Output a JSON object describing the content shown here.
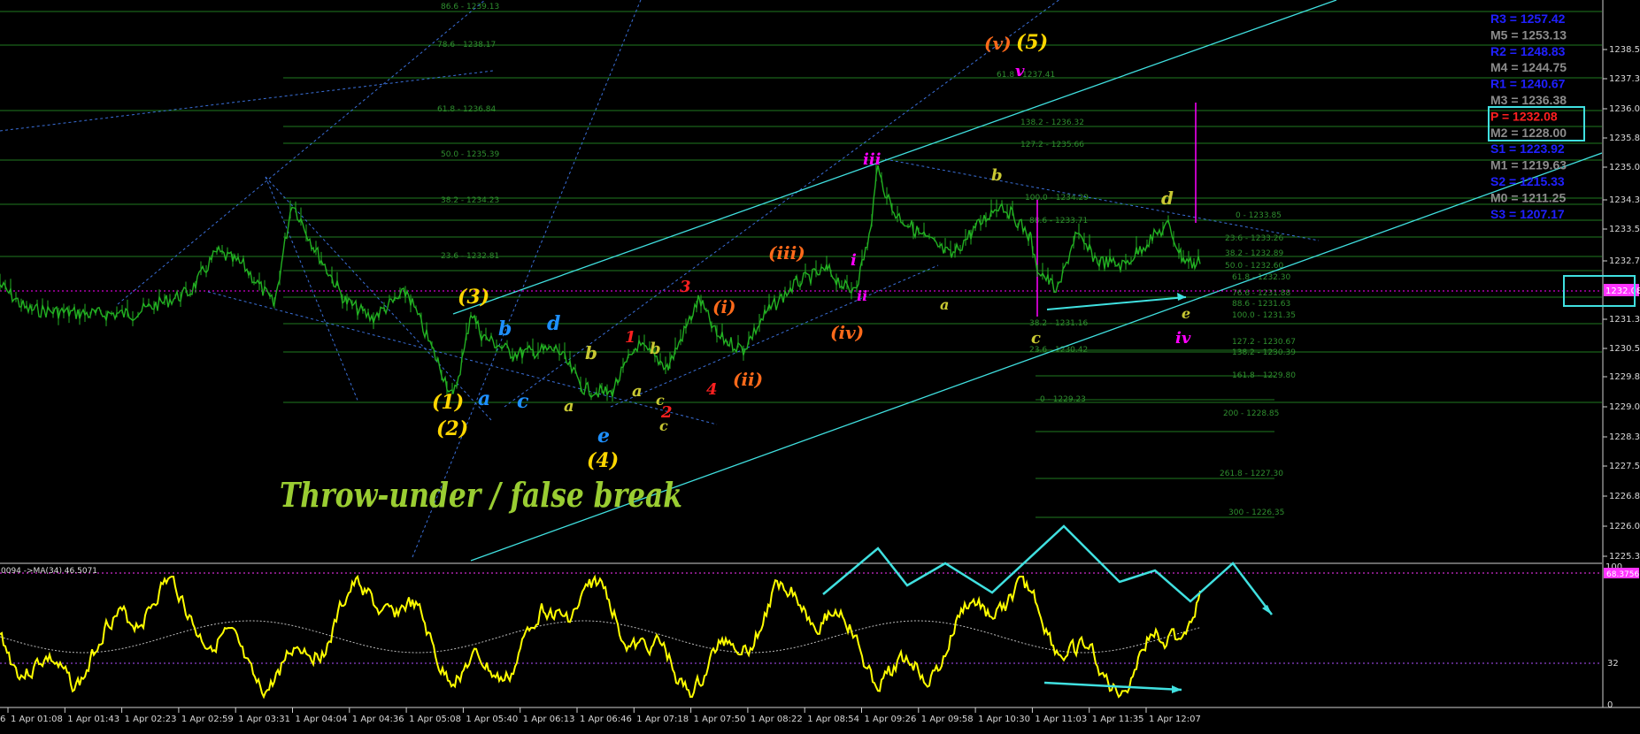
{
  "chart_data": {
    "type": "line",
    "symbol": "XAUUSD",
    "caption": "Throw-under / false break",
    "y_axis_labels": [
      "1238.58",
      "1237.31",
      "1236.04",
      "1235.81",
      "1235.04",
      "1234.31",
      "1233.59",
      "1232.75",
      "1231.31",
      "1230.56",
      "1229.81",
      "1229.06",
      "1228.31",
      "1227.56",
      "1226.81",
      "1226.06",
      "1225.31"
    ],
    "current_price_label": "1232.08",
    "x_axis_labels": [
      "1 Apr 01:08",
      "1 Apr 01:43",
      "1 Apr 02:23",
      "1 Apr 02:59",
      "1 Apr 03:31",
      "1 Apr 04:04",
      "1 Apr 04:36",
      "1 Apr 05:08",
      "1 Apr 05:40",
      "1 Apr 06:13",
      "1 Apr 06:46",
      "1 Apr 07:18",
      "1 Apr 07:50",
      "1 Apr 08:22",
      "1 Apr 08:54",
      "1 Apr 09:26",
      "1 Apr 09:58",
      "1 Apr 10:30",
      "1 Apr 11:03",
      "1 Apr 11:35",
      "1 Apr 12:07"
    ],
    "x_axis_edge_label": "6",
    "pivots": [
      {
        "label": "R3",
        "value": "1257.42",
        "color": "#2020ff"
      },
      {
        "label": "M5",
        "value": "1253.13",
        "color": "#8c8c8c"
      },
      {
        "label": "R2",
        "value": "1248.83",
        "color": "#2020ff"
      },
      {
        "label": "M4",
        "value": "1244.75",
        "color": "#8c8c8c"
      },
      {
        "label": "R1",
        "value": "1240.67",
        "color": "#2020ff"
      },
      {
        "label": "M3",
        "value": "1236.38",
        "color": "#8c8c8c"
      },
      {
        "label": "P",
        "value": "1232.08",
        "color": "#ff2020"
      },
      {
        "label": "M2",
        "value": "1228.00",
        "color": "#8c8c8c"
      },
      {
        "label": "S1",
        "value": "1223.92",
        "color": "#2020ff"
      },
      {
        "label": "M1",
        "value": "1219.63",
        "color": "#8c8c8c"
      },
      {
        "label": "S2",
        "value": "1215.33",
        "color": "#2020ff"
      },
      {
        "label": "M0",
        "value": "1211.25",
        "color": "#8c8c8c"
      },
      {
        "label": "S3",
        "value": "1207.17",
        "color": "#2020ff"
      }
    ],
    "fib_left": [
      "86.6 - 1239.13",
      "78.6 - 1238.17",
      "61.8 - 1236.84",
      "50.0 - 1235.39",
      "38.2 - 1234.23",
      "23.6 - 1232.81"
    ],
    "fib_mid": [
      "61.8 - 1237.41",
      "138.2 - 1236.32",
      "127.2 - 1235.66",
      "100.0 - 1234.29",
      "88.6 - 1233.71",
      "38.2 - 1231.16",
      "23.6 - 1230.42",
      "0 - 1229.23"
    ],
    "fib_right": [
      "0 - 1233.85",
      "23.6 - 1233.26",
      "38.2 - 1232.89",
      "50.0 - 1232.60",
      "61.8 - 1232.30",
      "76.6 - 1231.88",
      "88.6 - 1231.63",
      "100.0 - 1231.35",
      "127.2 - 1230.67",
      "138.2 - 1230.39",
      "161.8 - 1229.80",
      "200 - 1228.85",
      "261.8 - 1227.30",
      "300 - 1226.35"
    ],
    "wave_labels": [
      {
        "text": "(1)",
        "color": "#ffd700"
      },
      {
        "text": "(2)",
        "color": "#ffd700"
      },
      {
        "text": "(3)",
        "color": "#ffd700"
      },
      {
        "text": "(4)",
        "color": "#ffd700"
      },
      {
        "text": "(5)",
        "color": "#ffd700"
      },
      {
        "text": "a",
        "color": "#1e90ff"
      },
      {
        "text": "b",
        "color": "#1e90ff"
      },
      {
        "text": "c",
        "color": "#1e90ff"
      },
      {
        "text": "d",
        "color": "#1e90ff"
      },
      {
        "text": "e",
        "color": "#1e90ff"
      },
      {
        "text": "a",
        "color": "#c8c832"
      },
      {
        "text": "b",
        "color": "#c8c832"
      },
      {
        "text": "c",
        "color": "#c8c832"
      },
      {
        "text": "a",
        "color": "#c8c832"
      },
      {
        "text": "b",
        "color": "#c8c832"
      },
      {
        "text": "c",
        "color": "#c8c832"
      },
      {
        "text": "1",
        "color": "#ff2020"
      },
      {
        "text": "2",
        "color": "#ff2020"
      },
      {
        "text": "3",
        "color": "#ff2020"
      },
      {
        "text": "4",
        "color": "#ff2020"
      },
      {
        "text": "(i)",
        "color": "#ff6a1a"
      },
      {
        "text": "(ii)",
        "color": "#ff6a1a"
      },
      {
        "text": "(iii)",
        "color": "#ff6a1a"
      },
      {
        "text": "(iv)",
        "color": "#ff6a1a"
      },
      {
        "text": "(v)",
        "color": "#ff6a1a"
      },
      {
        "text": "i",
        "color": "#ff00ff"
      },
      {
        "text": "ii",
        "color": "#ff00ff"
      },
      {
        "text": "iii",
        "color": "#ff00ff"
      },
      {
        "text": "iv",
        "color": "#ff00ff"
      },
      {
        "text": "v",
        "color": "#ff00ff"
      },
      {
        "text": "a",
        "color": "#c8c832"
      },
      {
        "text": "b",
        "color": "#c8c832"
      },
      {
        "text": "c",
        "color": "#c8c832"
      },
      {
        "text": "d",
        "color": "#c8c832"
      },
      {
        "text": "e",
        "color": "#c8c832"
      }
    ],
    "indicator": {
      "title": "0094  ->MA(34) 46.5071",
      "levels": [
        "100",
        "32",
        "0"
      ],
      "level_value_label": "68.3756"
    },
    "price_line_color": "#22b022",
    "indicator_color": "#ffff00",
    "trendline_color": "#40e0e0"
  }
}
